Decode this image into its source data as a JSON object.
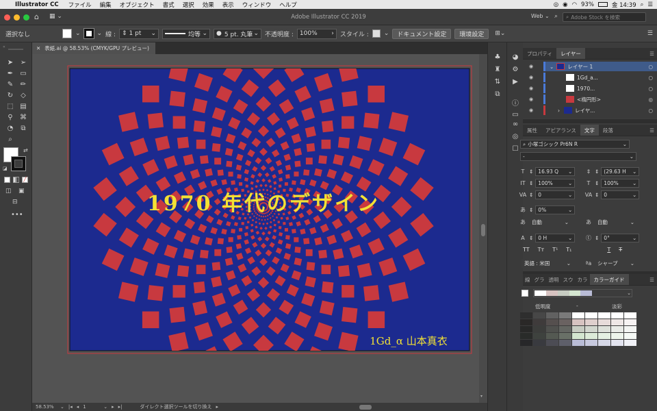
{
  "menubar": {
    "app_name": "Illustrator CC",
    "items": [
      "ファイル",
      "編集",
      "オブジェクト",
      "書式",
      "選択",
      "効果",
      "表示",
      "ウィンドウ",
      "ヘルプ"
    ],
    "battery": "93%",
    "clock": "金 14:39"
  },
  "titlebar": {
    "title": "Adobe Illustrator CC 2019",
    "workspace": "Web",
    "search_placeholder": "Adobe Stock を検索"
  },
  "controlbar": {
    "selection": "選択なし",
    "stroke_label": "線 :",
    "stroke_weight": "1 pt",
    "stroke_profile": "均等",
    "brush": "5 pt. 丸筆",
    "opacity_label": "不透明度 :",
    "opacity": "100%",
    "style_label": "スタイル :",
    "doc_settings": "ドキュメント設定",
    "preferences": "環境設定"
  },
  "document": {
    "tab_title": "表紙.ai @ 58.53% (CMYK/GPU プレビュー)",
    "artwork_title": "1970 年代のデザイン",
    "artwork_signature": "1Gd_α 山本真衣",
    "background_color": "#1c2a8f",
    "square_color": "#c8393f",
    "text_color": "#f2e135"
  },
  "statusbar": {
    "zoom": "58.53%",
    "artboard": "1",
    "hint": "ダイレクト選択ツールを切り換え"
  },
  "layers_panel": {
    "tabs": [
      "プロパティ",
      "レイヤー"
    ],
    "rows": [
      {
        "name": "レイヤー 1",
        "level": 0
      },
      {
        "name": "1Gd_a...",
        "level": 1
      },
      {
        "name": "1970...",
        "level": 1
      },
      {
        "name": "<楕円形>",
        "level": 1
      },
      {
        "name": "レイヤ...",
        "level": 1
      }
    ]
  },
  "character_panel": {
    "tabs": [
      "属性",
      "アピアランス",
      "文字",
      "段落"
    ],
    "font_family": "小塚ゴシック Pr6N R",
    "font_style": "-",
    "font_size": "16.93 Q",
    "leading": "(29.63 H",
    "vertical_scale": "100%",
    "horizontal_scale": "100%",
    "kerning": "0",
    "tracking": "0",
    "tsume": "0%",
    "aki_left": "自動",
    "aki_right": "自動",
    "baseline_shift": "0 H",
    "rotation": "0°",
    "language": "英語 : 米国",
    "antialias": "シャープ"
  },
  "color_guide_panel": {
    "tabs": [
      "線",
      "グラ",
      "透明",
      "スウ",
      "カラ",
      "カラーガイド"
    ],
    "left_label": "低明度",
    "middle_label": "-",
    "right_label": "淡彩"
  }
}
